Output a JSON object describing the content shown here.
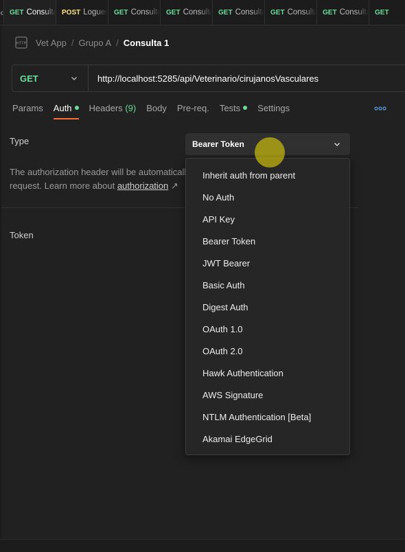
{
  "tabs": [
    {
      "method": "GET",
      "name": "Consulta",
      "active": true
    },
    {
      "method": "POST",
      "name": "Logueo",
      "active": false
    },
    {
      "method": "GET",
      "name": "Consulta",
      "active": false
    },
    {
      "method": "GET",
      "name": "Consulta",
      "active": false
    },
    {
      "method": "GET",
      "name": "Consulta",
      "active": false
    },
    {
      "method": "GET",
      "name": "Consulta",
      "active": false
    },
    {
      "method": "GET",
      "name": "Consulta",
      "active": false
    },
    {
      "method": "GET",
      "name": "",
      "active": false
    }
  ],
  "breadcrumb": {
    "workspace": "Vet App",
    "folder": "Grupo A",
    "current": "Consulta 1",
    "separator": "/"
  },
  "request": {
    "method": "GET",
    "url": "http://localhost:5285/api/Veterinario/cirujanosVasculares"
  },
  "request_tabs": {
    "params": "Params",
    "auth": "Auth",
    "headers": "Headers",
    "headers_count": "(9)",
    "body": "Body",
    "prereq": "Pre-req.",
    "tests": "Tests",
    "settings": "Settings"
  },
  "auth": {
    "type_label": "Type",
    "selected_type": "Bearer Token",
    "description_line1": "The authorization header will be automatically",
    "description_line2_prefix": "request. Learn more about ",
    "description_link": "authorization",
    "description_arrow": "↗",
    "token_label": "Token",
    "options": [
      "Inherit auth from parent",
      "No Auth",
      "API Key",
      "Bearer Token",
      "JWT Bearer",
      "Basic Auth",
      "Digest Auth",
      "OAuth 1.0",
      "OAuth 2.0",
      "Hawk Authentication",
      "AWS Signature",
      "NTLM Authentication [Beta]",
      "Akamai EdgeGrid"
    ]
  },
  "colors": {
    "get": "#6bdd9a",
    "post": "#ffe47e",
    "accent": "#ff6c37",
    "background": "#212121"
  },
  "icons": {
    "back": "chevron-left-icon",
    "request_type": "http-icon",
    "more": "more-horizontal-icon",
    "dropdown": "chevron-down-icon"
  }
}
